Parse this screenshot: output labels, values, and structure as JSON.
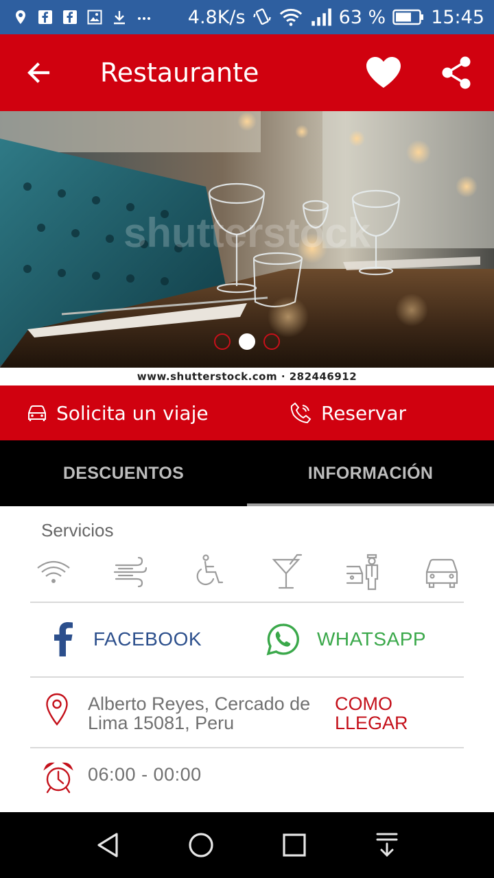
{
  "status_bar": {
    "network_speed": "4.8K/s",
    "battery_percent": "63 %",
    "time": "15:45",
    "icons": [
      "location-icon",
      "facebook-notif-icon",
      "facebook-notif-icon",
      "image-notif-icon",
      "download-icon",
      "more-icon",
      "vibrate-icon",
      "wifi-icon",
      "signal-icon",
      "battery-icon"
    ]
  },
  "appbar": {
    "title": "Restaurante",
    "background": "#d0010f"
  },
  "hero": {
    "caption": "www.shutterstock.com · 282446912",
    "watermark": "shutterstock",
    "slides": [
      {
        "state": "inactive"
      },
      {
        "state": "active"
      },
      {
        "state": "inactive"
      }
    ]
  },
  "actions": {
    "ride_label": "Solicita un viaje",
    "reserve_label": "Reservar"
  },
  "tabs": [
    {
      "label": "DESCUENTOS",
      "active": false
    },
    {
      "label": "INFORMACIÓN",
      "active": true
    }
  ],
  "info": {
    "services_label": "Servicios",
    "services": [
      "wifi-icon",
      "air-conditioning-icon",
      "wheelchair-icon",
      "cocktail-icon",
      "valet-parking-icon",
      "car-icon"
    ],
    "facebook_label": "FACEBOOK",
    "whatsapp_label": "WHATSAPP",
    "address": "Alberto Reyes, Cercado de Lima 15081, Peru",
    "directions_label": "COMO LLEGAR",
    "hours": "06:00 - 00:00"
  },
  "colors": {
    "brand_red": "#d0010f",
    "status_blue": "#2e5fa0",
    "facebook_blue": "#2c4f8c",
    "whatsapp_green": "#3aa84a"
  }
}
